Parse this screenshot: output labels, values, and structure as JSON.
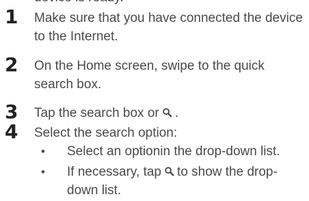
{
  "cut_top_text": "device is ready.",
  "steps": [
    {
      "number": "1",
      "text": "Make sure that you have connected the device to the Internet."
    },
    {
      "number": "2",
      "text": "On the Home screen, swipe to the quick search box."
    },
    {
      "number": "3",
      "text_before": "Tap the search box or",
      "text_after": "."
    },
    {
      "number": "4",
      "text": "Select the search option:"
    }
  ],
  "bullets": [
    {
      "dot": "•",
      "text": "Select an optionin the drop-down list."
    },
    {
      "dot": "•",
      "text_before": "If necessary, tap",
      "text_after": "to show the drop-down list."
    }
  ],
  "colors": {
    "text": "#4a4a4a",
    "number": "#222222"
  },
  "icons": {
    "search": "search-icon"
  }
}
